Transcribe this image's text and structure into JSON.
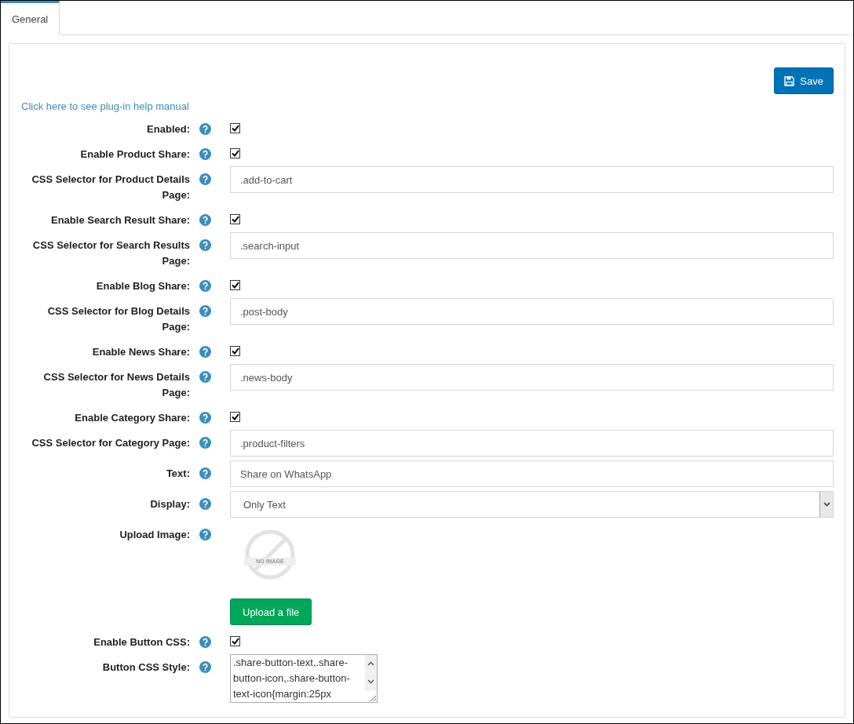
{
  "tabs": [
    {
      "label": "General",
      "selected": true
    }
  ],
  "save_button": "Save",
  "help_link": "Click here to see plug-in help manual",
  "fields": [
    {
      "kind": "checkbox",
      "label": "Enabled:",
      "checked": true
    },
    {
      "kind": "checkbox",
      "label": "Enable Product Share:",
      "checked": true
    },
    {
      "kind": "text",
      "label": "CSS Selector for Product Details Page:",
      "value": ".add-to-cart"
    },
    {
      "kind": "checkbox",
      "label": "Enable Search Result Share:",
      "checked": true
    },
    {
      "kind": "text",
      "label": "CSS Selector for Search Results Page:",
      "value": ".search-input"
    },
    {
      "kind": "checkbox",
      "label": "Enable Blog Share:",
      "checked": true
    },
    {
      "kind": "text",
      "label": "CSS Selector for Blog Details Page:",
      "value": ".post-body"
    },
    {
      "kind": "checkbox",
      "label": "Enable News Share:",
      "checked": true
    },
    {
      "kind": "text",
      "label": "CSS Selector for News Details Page:",
      "value": ".news-body"
    },
    {
      "kind": "checkbox",
      "label": "Enable Category Share:",
      "checked": true
    },
    {
      "kind": "text",
      "label": "CSS Selector for Category Page:",
      "value": ".product-filters"
    },
    {
      "kind": "text",
      "label": "Text:",
      "value": "Share on WhatsApp"
    },
    {
      "kind": "select",
      "label": "Display:",
      "value": "Only Text"
    },
    {
      "kind": "image",
      "label": "Upload Image:",
      "placeholder_text": "NO IMAGE",
      "button": "Upload a file"
    },
    {
      "kind": "checkbox",
      "label": "Enable Button CSS:",
      "checked": true
    },
    {
      "kind": "textarea",
      "label": "Button CSS Style:",
      "value": ".share-button-text,.share-button-icon,.share-button-text-icon{margin:25px"
    }
  ]
}
